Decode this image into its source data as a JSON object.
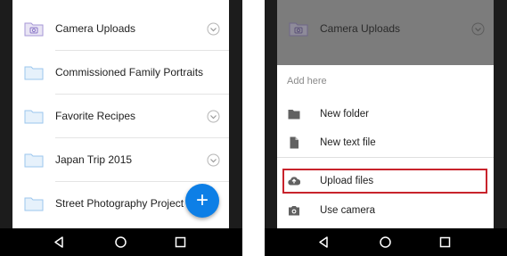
{
  "left_screen": {
    "files": [
      {
        "name": "Camera Uploads",
        "icon": "camera-folder-icon",
        "chevron": true
      },
      {
        "name": "Commissioned Family Portraits",
        "icon": "folder-icon",
        "chevron": false
      },
      {
        "name": "Favorite Recipes",
        "icon": "folder-icon",
        "chevron": true
      },
      {
        "name": "Japan Trip 2015",
        "icon": "folder-icon",
        "chevron": true
      },
      {
        "name": "Street Photography Project",
        "icon": "folder-icon",
        "chevron": false
      }
    ],
    "fab_label": "+"
  },
  "right_screen": {
    "background_file": "Camera Uploads",
    "sheet_title": "Add here",
    "menu": [
      {
        "label": "New folder",
        "icon": "folder-icon"
      },
      {
        "label": "New text file",
        "icon": "document-icon"
      },
      {
        "label": "Upload files",
        "icon": "cloud-upload-icon",
        "highlighted": true
      },
      {
        "label": "Use camera",
        "icon": "camera-icon"
      }
    ]
  },
  "colors": {
    "accent": "#0d7fe6",
    "folder": "#9bc6ee",
    "highlight": "#c8232c",
    "nav_bar": "#000000",
    "phone_body": "#1c1c1c"
  }
}
